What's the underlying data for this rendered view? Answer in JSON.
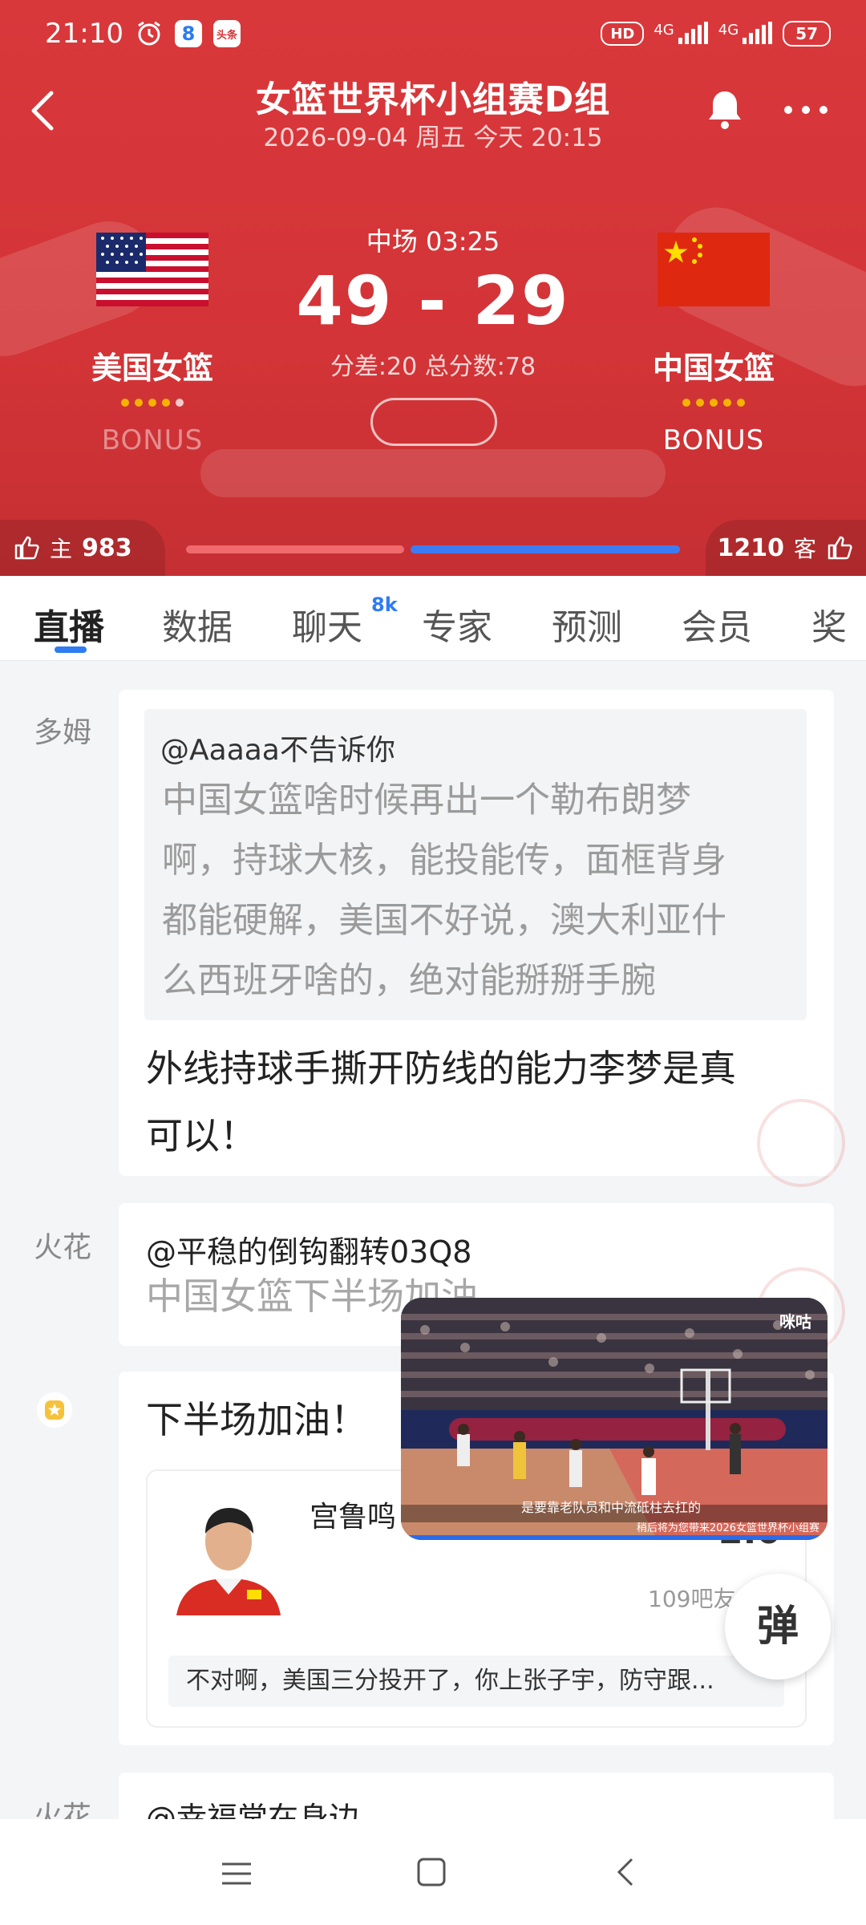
{
  "status_bar": {
    "time": "21:10",
    "app_badge": "8",
    "toutiao": "头条",
    "net1": "4G",
    "net2": "4G",
    "battery": "57",
    "hd": "HD"
  },
  "header": {
    "title": "女篮世界杯小组赛D组",
    "subtitle": "2026-09-04 周五 今天 20:15"
  },
  "match": {
    "clock": "中场 03:25",
    "score": "49 - 29",
    "diff": "分差:20 总分数:78",
    "home": {
      "name": "美国女篮",
      "bonus": "BONUS",
      "fouls_active": 4,
      "fouls_total": 5,
      "bonus_color": "rgba(255,255,255,0.45)"
    },
    "away": {
      "name": "中国女篮",
      "bonus": "BONUS",
      "fouls_active": 5,
      "fouls_total": 5,
      "bonus_color": "#ffffff"
    }
  },
  "support": {
    "home_label": "主",
    "home_count": "983",
    "away_label": "客",
    "away_count": "1210",
    "home_share": 0.45,
    "away_share": 0.55
  },
  "tabs": [
    {
      "label": "直播",
      "active": true
    },
    {
      "label": "数据",
      "active": false
    },
    {
      "label": "聊天",
      "active": false,
      "badge": "8k"
    },
    {
      "label": "专家",
      "active": false
    },
    {
      "label": "预测",
      "active": false
    },
    {
      "label": "会员",
      "active": false
    },
    {
      "label": "奖",
      "active": false
    }
  ],
  "feed": [
    {
      "user": "多姆",
      "quote_user": "@Aaaaa不告诉你",
      "quote_lines": [
        "中国女篮啥时候再出一个勒布朗梦",
        "啊，持球大核，能投能传，面框背身",
        "都能硬解，美国不好说，澳大利亚什",
        "么西班牙啥的，绝对能掰掰手腕"
      ],
      "text_lines": [
        "外线持球手撕开防线的能力李梦是真",
        "可以！"
      ]
    },
    {
      "user": "火花",
      "quote_user": "@平稳的倒钩翻转03Q8",
      "quote_lines": [
        "中国女篮下半场加油"
      ]
    },
    {
      "user_icon": "star-badge-icon",
      "text": "下半场加油！",
      "expert": {
        "name": "宫鲁鸣",
        "value": "2.0",
        "fans": "109吧友",
        "note": "不对啊，美国三分投开了，你上张子宇，防守跟..."
      }
    },
    {
      "user": "火花",
      "quote_user": "@幸福常在身边"
    }
  ],
  "video": {
    "caption": "是要靠老队员和中流砥柱去扛的",
    "logo": "咪咕",
    "ticker": "稍后将为您带来2026女篮世界杯小组赛"
  },
  "danmu_button": "弹"
}
